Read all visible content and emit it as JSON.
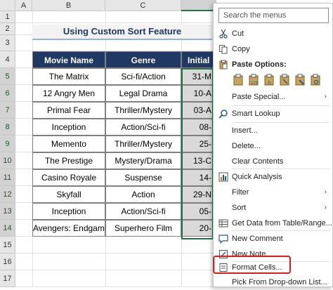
{
  "columns": [
    "A",
    "B",
    "C"
  ],
  "rows": [
    "1",
    "2",
    "3",
    "4",
    "5",
    "6",
    "7",
    "8",
    "9",
    "10",
    "11",
    "12",
    "13",
    "14",
    "15",
    "16",
    "17"
  ],
  "title": "Using Custom Sort Feature",
  "table": {
    "headers": [
      "Movie Name",
      "Genre",
      "Initial"
    ],
    "rows": [
      [
        "The Matrix",
        "Sci-fi/Action",
        "31-M"
      ],
      [
        "12 Angry Men",
        "Legal Drama",
        "10-A"
      ],
      [
        "Primal Fear",
        "Thriller/Mystery",
        "03-A"
      ],
      [
        "Inception",
        "Action/Sci-fi",
        "08-"
      ],
      [
        "Memento",
        "Thriller/Mystery",
        "25-"
      ],
      [
        "The Prestige",
        "Mystery/Drama",
        "13-C"
      ],
      [
        "Casino Royale",
        "Suspense",
        "14-"
      ],
      [
        "Skyfall",
        "Action",
        "29-N"
      ],
      [
        "Inception",
        "Action/Sci-fi",
        "05-"
      ],
      [
        "Avengers: Endgame",
        "Superhero Film",
        "20-"
      ]
    ]
  },
  "menu": {
    "search_placeholder": "Search the menus",
    "items": {
      "cut": "Cut",
      "copy": "Copy",
      "paste_options": "Paste Options:",
      "paste_special": "Paste Special...",
      "smart_lookup": "Smart Lookup",
      "insert": "Insert...",
      "delete": "Delete...",
      "clear_contents": "Clear Contents",
      "quick_analysis": "Quick Analysis",
      "filter": "Filter",
      "sort": "Sort",
      "get_data": "Get Data from Table/Range...",
      "new_comment": "New Comment",
      "new_note": "New Note",
      "format_cells": "Format Cells...",
      "pick_dropdown": "Pick From Drop-down List..."
    }
  },
  "colors": {
    "header_bg": "#203864",
    "selection": "#217346",
    "highlight": "#e31a1a"
  }
}
